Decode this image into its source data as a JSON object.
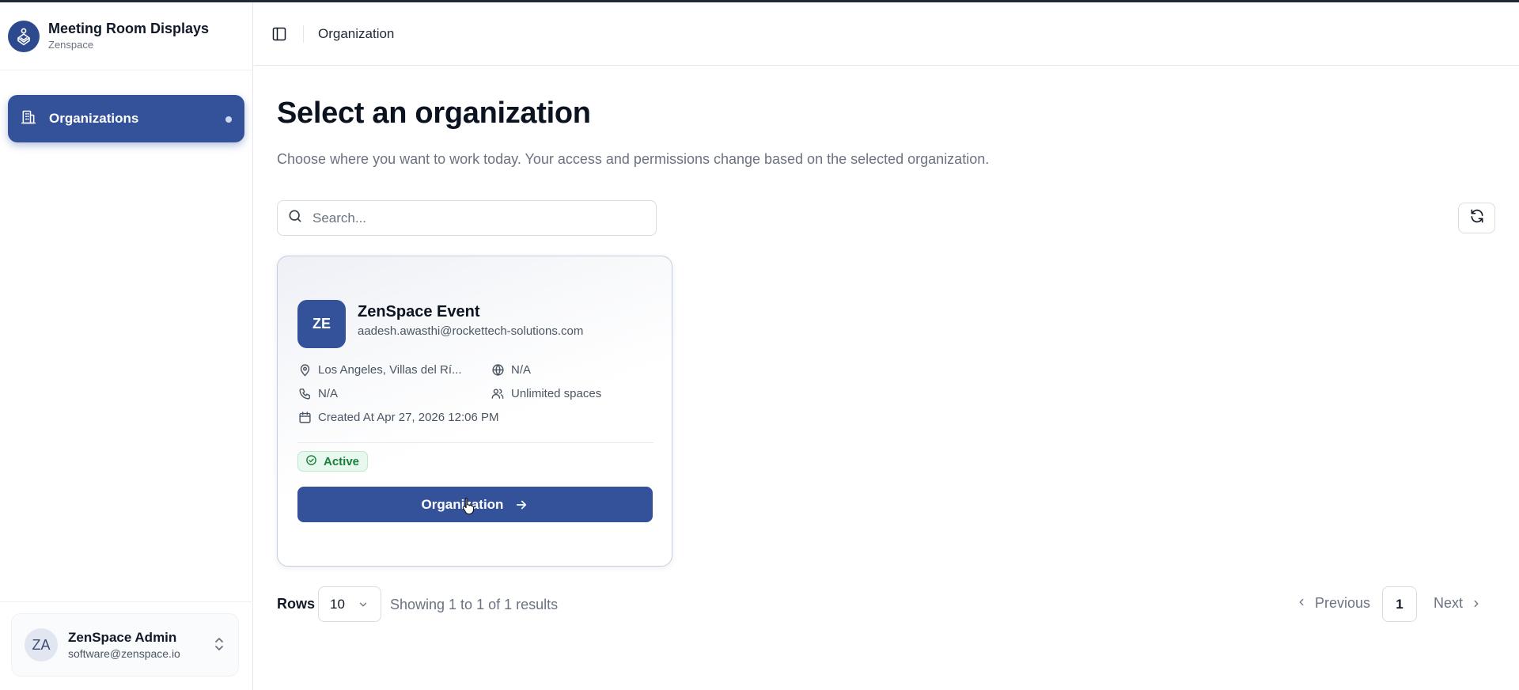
{
  "app": {
    "title": "Meeting Room Displays",
    "subtitle": "Zenspace",
    "logo_icon": "app-logo-icon"
  },
  "sidebar": {
    "items": [
      {
        "label": "Organizations",
        "icon": "building-icon",
        "active": true
      }
    ]
  },
  "user": {
    "initials": "ZA",
    "name": "ZenSpace Admin",
    "email": "software@zenspace.io"
  },
  "header": {
    "breadcrumb": "Organization"
  },
  "main": {
    "title": "Select an organization",
    "description": "Choose where you want to work today. Your access and permissions change based on the selected organization.",
    "search_placeholder": "Search..."
  },
  "organizations": [
    {
      "initials": "ZE",
      "name": "ZenSpace Event",
      "email": "aadesh.awasthi@rockettech-solutions.com",
      "location": "Los Angeles, Villas del Rí...",
      "website": "N/A",
      "phone": "N/A",
      "spaces": "Unlimited spaces",
      "created": "Created At Apr 27, 2026 12:06 PM",
      "status": "Active",
      "button_label": "Organization"
    }
  ],
  "pagination": {
    "rows_label": "Rows",
    "rows_value": "10",
    "results_text": "Showing 1 to 1 of 1 results",
    "prev_label": "Previous",
    "current_page": "1",
    "next_label": "Next"
  },
  "colors": {
    "primary": "#34529a",
    "active_status": "#16803c",
    "active_status_bg": "#e9f8ee"
  }
}
